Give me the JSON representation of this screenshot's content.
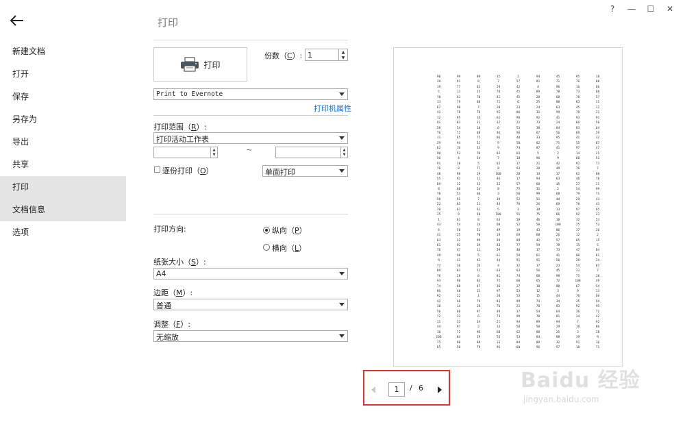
{
  "window_controls": {
    "help": "?",
    "minimize": "—",
    "maximize": "☐",
    "close": "✕"
  },
  "sidebar": {
    "items": [
      {
        "label": "新建文档"
      },
      {
        "label": "打开"
      },
      {
        "label": "保存"
      },
      {
        "label": "另存为"
      },
      {
        "label": "导出"
      },
      {
        "label": "共享"
      },
      {
        "label": "打印"
      },
      {
        "label": "文档信息"
      },
      {
        "label": "选项"
      }
    ]
  },
  "header": {
    "title": "打印"
  },
  "print_button": {
    "label": "打印"
  },
  "copies": {
    "label": "份数",
    "key": "C",
    "value": "1"
  },
  "printer": {
    "selected": "Print to Evernote",
    "properties_link": "打印机属性"
  },
  "range": {
    "label": "打印范围",
    "key": "R",
    "selected": "打印活动工作表",
    "separator": "~"
  },
  "collate": {
    "label": "逐份打印",
    "key": "O"
  },
  "duplex": {
    "selected": "单面打印"
  },
  "orientation": {
    "label": "打印方向:",
    "portrait_label": "纵向",
    "portrait_key": "P",
    "landscape_label": "横向",
    "landscape_key": "L"
  },
  "paper_size": {
    "label": "纸张大小",
    "key": "S",
    "selected": "A4"
  },
  "margins": {
    "label": "边距",
    "key": "M",
    "selected": "普通"
  },
  "scaling": {
    "label": "调整",
    "key": "F",
    "selected": "无缩放"
  },
  "preview": {
    "rows": [
      [
        "90",
        "99",
        "89",
        "35",
        "2",
        "94",
        "45",
        "95",
        "18"
      ],
      [
        "39",
        "91",
        "8",
        "7",
        "57",
        "81",
        "71",
        "76",
        "88"
      ],
      [
        "19",
        "77",
        "63",
        "29",
        "42",
        "4",
        "96",
        "16",
        "66"
      ],
      [
        "5",
        "13",
        "25",
        "78",
        "45",
        "89",
        "78",
        "73",
        "88"
      ],
      [
        "70",
        "63",
        "78",
        "41",
        "45",
        "28",
        "68",
        "78",
        "57"
      ],
      [
        "13",
        "79",
        "68",
        "71",
        "6",
        "25",
        "80",
        "83",
        "31"
      ],
      [
        "67",
        "98",
        "7",
        "20",
        "23",
        "24",
        "63",
        "45",
        "22"
      ],
      [
        "41",
        "78",
        "70",
        "92",
        "86",
        "31",
        "99",
        "78",
        "21"
      ],
      [
        "12",
        "95",
        "16",
        "62",
        "96",
        "92",
        "41",
        "93",
        "91"
      ],
      [
        "91",
        "83",
        "32",
        "32",
        "22",
        "73",
        "24",
        "66",
        "56"
      ],
      [
        "50",
        "54",
        "10",
        "6",
        "53",
        "38",
        "84",
        "83",
        "64"
      ],
      [
        "76",
        "72",
        "68",
        "36",
        "96",
        "67",
        "56",
        "69",
        "29"
      ],
      [
        "11",
        "65",
        "75",
        "86",
        "48",
        "33",
        "95",
        "41",
        "32"
      ],
      [
        "29",
        "94",
        "51",
        "9",
        "50",
        "82",
        "71",
        "55",
        "87"
      ],
      [
        "62",
        "16",
        "33",
        "9",
        "74",
        "87",
        "41",
        "97",
        "47"
      ],
      [
        "90",
        "53",
        "70",
        "62",
        "63",
        "5",
        "2",
        "14",
        "21"
      ],
      [
        "56",
        "4",
        "54",
        "7",
        "18",
        "96",
        "9",
        "60",
        "51"
      ],
      [
        "91",
        "18",
        "5",
        "63",
        "17",
        "21",
        "42",
        "92",
        "73"
      ],
      [
        "76",
        "8",
        "77",
        "8",
        "93",
        "28",
        "49",
        "76",
        "7"
      ],
      [
        "48",
        "98",
        "29",
        "100",
        "20",
        "14",
        "17",
        "61",
        "60"
      ],
      [
        "55",
        "92",
        "11",
        "46",
        "17",
        "94",
        "63",
        "46",
        "78"
      ],
      [
        "69",
        "32",
        "33",
        "32",
        "57",
        "68",
        "35",
        "27",
        "21"
      ],
      [
        "8",
        "68",
        "54",
        "8",
        "75",
        "31",
        "2",
        "54",
        "99"
      ],
      [
        "70",
        "53",
        "60",
        "3",
        "50",
        "99",
        "68",
        "79",
        "71"
      ],
      [
        "50",
        "91",
        "7",
        "19",
        "52",
        "51",
        "44",
        "29",
        "43"
      ],
      [
        "22",
        "83",
        "21",
        "44",
        "78",
        "26",
        "69",
        "78",
        "43"
      ],
      [
        "20",
        "62",
        "61",
        "5",
        "3",
        "39",
        "13",
        "97",
        "65"
      ],
      [
        "25",
        "9",
        "50",
        "100",
        "55",
        "75",
        "66",
        "92",
        "23"
      ],
      [
        "1",
        "61",
        "8",
        "63",
        "58",
        "46",
        "10",
        "32",
        "53"
      ],
      [
        "43",
        "54",
        "24",
        "60",
        "52",
        "58",
        "100",
        "25",
        "53"
      ],
      [
        "4",
        "58",
        "51",
        "49",
        "19",
        "43",
        "86",
        "37",
        "26"
      ],
      [
        "41",
        "25",
        "70",
        "19",
        "69",
        "60",
        "26",
        "12",
        "2"
      ],
      [
        "63",
        "32",
        "99",
        "39",
        "89",
        "42",
        "57",
        "65",
        "15"
      ],
      [
        "61",
        "92",
        "39",
        "43",
        "77",
        "59",
        "79",
        "15",
        "5"
      ],
      [
        "76",
        "47",
        "11",
        "39",
        "48",
        "17",
        "73",
        "47",
        "64"
      ],
      [
        "49",
        "40",
        "5",
        "61",
        "59",
        "61",
        "41",
        "80",
        "81"
      ],
      [
        "9",
        "31",
        "43",
        "44",
        "91",
        "91",
        "56",
        "26",
        "24"
      ],
      [
        "77",
        "36",
        "26",
        "4",
        "32",
        "17",
        "23",
        "54",
        "87"
      ],
      [
        "89",
        "83",
        "51",
        "63",
        "63",
        "56",
        "45",
        "22",
        "7"
      ],
      [
        "76",
        "28",
        "8",
        "81",
        "74",
        "68",
        "90",
        "71",
        "10"
      ],
      [
        "93",
        "90",
        "83",
        "75",
        "60",
        "65",
        "72",
        "100",
        "49"
      ],
      [
        "74",
        "88",
        "47",
        "36",
        "27",
        "18",
        "80",
        "67",
        "54"
      ],
      [
        "86",
        "48",
        "13",
        "97",
        "53",
        "12",
        "3",
        "9",
        "13"
      ],
      [
        "92",
        "22",
        "1",
        "20",
        "53",
        "15",
        "44",
        "76",
        "68"
      ],
      [
        "42",
        "46",
        "79",
        "83",
        "99",
        "74",
        "34",
        "35",
        "94"
      ],
      [
        "38",
        "14",
        "28",
        "76",
        "21",
        "78",
        "83",
        "92",
        "95"
      ],
      [
        "56",
        "68",
        "97",
        "49",
        "37",
        "54",
        "64",
        "26",
        "71"
      ],
      [
        "72",
        "33",
        "6",
        "73",
        "99",
        "78",
        "81",
        "34",
        "42"
      ],
      [
        "11",
        "33",
        "34",
        "21",
        "94",
        "89",
        "94",
        "7",
        "92"
      ],
      [
        "44",
        "97",
        "2",
        "13",
        "50",
        "58",
        "29",
        "10",
        "86"
      ],
      [
        "10",
        "72",
        "96",
        "60",
        "62",
        "88",
        "25",
        "3",
        "28"
      ],
      [
        "100",
        "84",
        "19",
        "53",
        "53",
        "84",
        "88",
        "39",
        "9"
      ],
      [
        "75",
        "90",
        "88",
        "13",
        "84",
        "89",
        "32",
        "91",
        "16"
      ],
      [
        "65",
        "50",
        "79",
        "96",
        "60",
        "96",
        "57",
        "10",
        "71"
      ]
    ]
  },
  "pager": {
    "current": "1",
    "separator": "/",
    "total": "6"
  },
  "watermark": {
    "brand": "Baidu 经验",
    "url": "jingyan.baidu.com"
  }
}
